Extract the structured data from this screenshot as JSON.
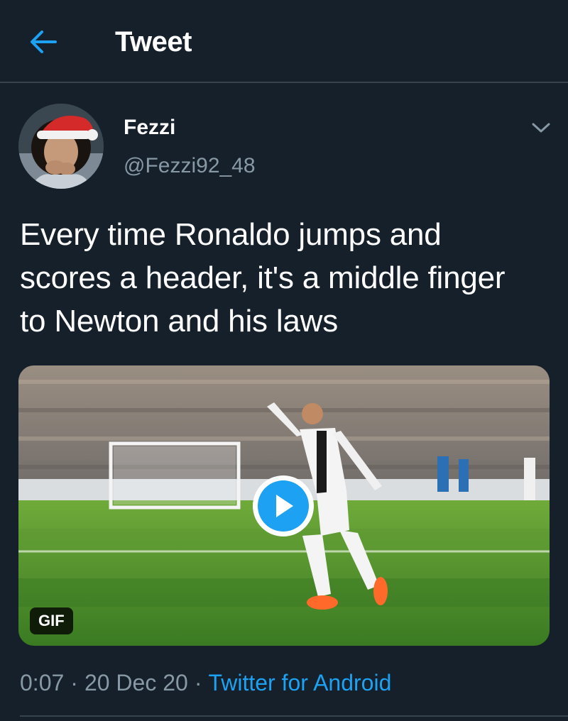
{
  "header": {
    "title": "Tweet",
    "back_icon": "arrow-left-icon",
    "accent_color": "#1da1f2"
  },
  "author": {
    "display_name": "Fezzi",
    "handle": "@Fezzi92_48",
    "avatar_icon": "avatar-santa-hat"
  },
  "tweet": {
    "text": "Every time Ronaldo jumps and scores a header, it's a middle finger to Newton and his laws"
  },
  "media": {
    "type": "gif",
    "badge": "GIF",
    "play_icon": "play-icon"
  },
  "meta": {
    "time": "0:07",
    "date": "20 Dec 20",
    "separator": "·",
    "source": "Twitter for Android"
  },
  "colors": {
    "background": "#15202b",
    "divider": "#38444d",
    "secondary_text": "#8899a6",
    "link": "#1da1f2"
  }
}
